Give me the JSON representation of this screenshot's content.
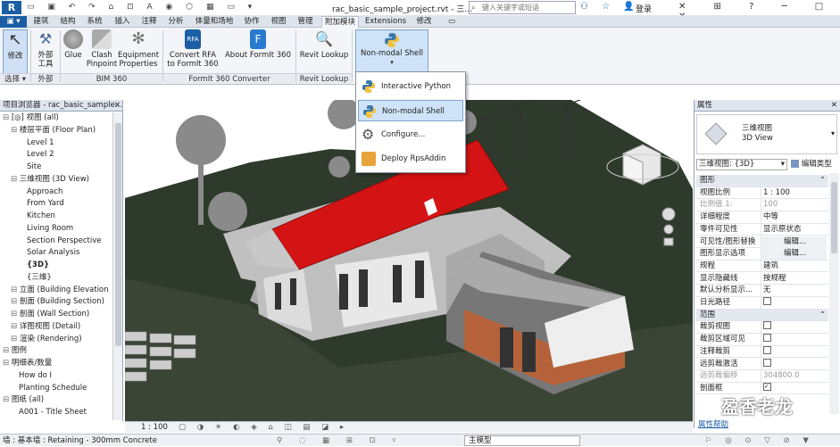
{
  "titlebar": {
    "filename": "rac_basic_sample_project.rvt - 三...",
    "search_placeholder": "键入关键字或短语",
    "user": "登录"
  },
  "app_tabs": [
    "建筑",
    "结构",
    "系统",
    "插入",
    "注释",
    "分析",
    "体量和场地",
    "协作",
    "视图",
    "管理",
    "附加模块",
    "Extensions",
    "修改"
  ],
  "active_tab": "附加模块",
  "ribbon": {
    "modify": "修改",
    "external_tools": "外部\n工具",
    "glue": "Glue",
    "clash": "Clash\nPinpoint",
    "equipment": "Equipment\nProperties",
    "convert_rfa": "Convert RFA\nto FormIt 360",
    "about_formit": "About FormIt 360",
    "revit_lookup": "Revit Lookup",
    "nonmodal": "Non-modal Shell",
    "panels": {
      "select": "选择 ▾",
      "external": "外部",
      "bim360": "BIM 360",
      "formit": "FormIt 360 Converter",
      "lookup": "Revit Lookup"
    }
  },
  "dropdown": [
    "Interactive Python Shell",
    "Non-modal Shell",
    "Configure...",
    "Deploy RpsAddin"
  ],
  "browser": {
    "title": "项目浏览器 - rac_basic_sample...",
    "items": [
      {
        "t": "[◎] 视图 (all)",
        "d": 0
      },
      {
        "t": "楼层平面 (Floor Plan)",
        "d": 1
      },
      {
        "t": "Level 1",
        "d": 3
      },
      {
        "t": "Level 2",
        "d": 3
      },
      {
        "t": "Site",
        "d": 3
      },
      {
        "t": "三维视图 (3D View)",
        "d": 1
      },
      {
        "t": "Approach",
        "d": 3
      },
      {
        "t": "From Yard",
        "d": 3
      },
      {
        "t": "Kitchen",
        "d": 3
      },
      {
        "t": "Living Room",
        "d": 3
      },
      {
        "t": "Section Perspective",
        "d": 3
      },
      {
        "t": "Solar Analysis",
        "d": 3
      },
      {
        "t": "{3D}",
        "d": 3
      },
      {
        "t": "{三维}",
        "d": 3
      },
      {
        "t": "立面 (Building Elevation",
        "d": 1
      },
      {
        "t": "剖面 (Building Section)",
        "d": 1
      },
      {
        "t": "剖面 (Wall Section)",
        "d": 1
      },
      {
        "t": "详图视图 (Detail)",
        "d": 1
      },
      {
        "t": "渲染 (Rendering)",
        "d": 1
      },
      {
        "t": "图例",
        "d": 0
      },
      {
        "t": "明细表/数量",
        "d": 0
      },
      {
        "t": "How do I",
        "d": 2
      },
      {
        "t": "Planting Schedule",
        "d": 2
      },
      {
        "t": "图纸 (all)",
        "d": 0
      },
      {
        "t": "A001 - Title Sheet",
        "d": 2
      }
    ]
  },
  "props": {
    "title": "属性",
    "type_name": "三维视图\n3D View",
    "selector": "三维视图: {3D}",
    "edit_type": "编辑类型",
    "rows": [
      {
        "k": "图形",
        "v": "",
        "g": true
      },
      {
        "k": "视图比例",
        "v": "1 : 100"
      },
      {
        "k": "比例值 1:",
        "v": "100",
        "dim": true
      },
      {
        "k": "详细程度",
        "v": "中等"
      },
      {
        "k": "零件可见性",
        "v": "显示原状态"
      },
      {
        "k": "可见性/图形替换",
        "v": "编辑..."
      },
      {
        "k": "图形显示选项",
        "v": "编辑..."
      },
      {
        "k": "规程",
        "v": "建筑"
      },
      {
        "k": "显示隐藏线",
        "v": "按规程"
      },
      {
        "k": "默认分析显示...",
        "v": "无"
      },
      {
        "k": "日光路径",
        "v": "☐"
      },
      {
        "k": "范围",
        "v": "",
        "g": true
      },
      {
        "k": "裁剪视图",
        "v": "☐"
      },
      {
        "k": "裁剪区域可见",
        "v": "☐"
      },
      {
        "k": "注释裁剪",
        "v": "☐"
      },
      {
        "k": "远剪裁激活",
        "v": "☐"
      },
      {
        "k": "远剪裁偏移",
        "v": "304800.0",
        "dim": true
      },
      {
        "k": "剖面框",
        "v": "☑"
      }
    ],
    "help": "属性帮助"
  },
  "viewbar": {
    "scale": "1 : 100"
  },
  "status": {
    "text": "墙 : 基本墙 : Retaining - 300mm Concrete",
    "model": "主模型"
  },
  "watermark": "盈香老龙"
}
